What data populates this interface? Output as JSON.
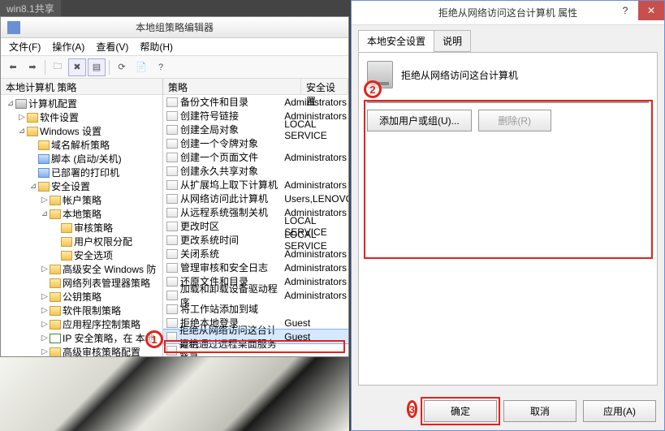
{
  "share_tab": "win8.1共享",
  "editor": {
    "title": "本地组策略编辑器",
    "menus": {
      "file": "文件(F)",
      "action": "操作(A)",
      "view": "查看(V)",
      "help": "帮助(H)"
    },
    "tree_header": "本地计算机 策略",
    "tree": [
      {
        "indent": 0,
        "tw": "⊿",
        "icon": "srv",
        "label": "计算机配置"
      },
      {
        "indent": 1,
        "tw": "▷",
        "icon": "f",
        "label": "软件设置"
      },
      {
        "indent": 1,
        "tw": "⊿",
        "icon": "f",
        "label": "Windows 设置"
      },
      {
        "indent": 2,
        "tw": "",
        "icon": "f",
        "label": "域名解析策略"
      },
      {
        "indent": 2,
        "tw": "",
        "icon": "blue",
        "label": "脚本 (启动/关机)"
      },
      {
        "indent": 2,
        "tw": "",
        "icon": "blue",
        "label": "已部署的打印机"
      },
      {
        "indent": 2,
        "tw": "⊿",
        "icon": "f",
        "label": "安全设置"
      },
      {
        "indent": 3,
        "tw": "▷",
        "icon": "f",
        "label": "帐户策略"
      },
      {
        "indent": 3,
        "tw": "⊿",
        "icon": "f",
        "label": "本地策略"
      },
      {
        "indent": 4,
        "tw": "",
        "icon": "f",
        "label": "审核策略"
      },
      {
        "indent": 4,
        "tw": "",
        "icon": "f",
        "label": "用户权限分配"
      },
      {
        "indent": 4,
        "tw": "",
        "icon": "f",
        "label": "安全选项"
      },
      {
        "indent": 3,
        "tw": "▷",
        "icon": "f",
        "label": "高级安全 Windows 防"
      },
      {
        "indent": 3,
        "tw": "",
        "icon": "f",
        "label": "网络列表管理器策略"
      },
      {
        "indent": 3,
        "tw": "▷",
        "icon": "f",
        "label": "公钥策略"
      },
      {
        "indent": 3,
        "tw": "▷",
        "icon": "f",
        "label": "软件限制策略"
      },
      {
        "indent": 3,
        "tw": "▷",
        "icon": "f",
        "label": "应用程序控制策略"
      },
      {
        "indent": 3,
        "tw": "▷",
        "icon": "ip",
        "label": "IP 安全策略，在 本地"
      },
      {
        "indent": 3,
        "tw": "▷",
        "icon": "f",
        "label": "高级审核策略配置"
      }
    ],
    "columns": {
      "policy": "策略",
      "setting": "安全设置"
    },
    "rows": [
      {
        "p": "备份文件和目录",
        "s": "Administrators"
      },
      {
        "p": "创建符号链接",
        "s": "Administrators"
      },
      {
        "p": "创建全局对象",
        "s": "LOCAL SERVICE"
      },
      {
        "p": "创建一个令牌对象",
        "s": ""
      },
      {
        "p": "创建一个页面文件",
        "s": "Administrators"
      },
      {
        "p": "创建永久共享对象",
        "s": ""
      },
      {
        "p": "从扩展坞上取下计算机",
        "s": "Administrators"
      },
      {
        "p": "从网络访问此计算机",
        "s": "Users,LENOVO"
      },
      {
        "p": "从远程系统强制关机",
        "s": "Administrators"
      },
      {
        "p": "更改时区",
        "s": "LOCAL SERVICE"
      },
      {
        "p": "更改系统时间",
        "s": "LOCAL SERVICE"
      },
      {
        "p": "关闭系统",
        "s": "Administrators"
      },
      {
        "p": "管理审核和安全日志",
        "s": "Administrators"
      },
      {
        "p": "还原文件和目录",
        "s": "Administrators"
      },
      {
        "p": "加载和卸载设备驱动程序",
        "s": "Administrators"
      },
      {
        "p": "将工作站添加到域",
        "s": ""
      },
      {
        "p": "拒绝本地登录",
        "s": "Guest"
      },
      {
        "p": "拒绝从网络访问这台计算机",
        "s": "Guest",
        "sel": true
      },
      {
        "p": "拒绝通过远程桌面服务登录",
        "s": ""
      }
    ]
  },
  "prop": {
    "title": "拒绝从网络访问这台计算机 属性",
    "tabs": {
      "security": "本地安全设置",
      "explain": "说明"
    },
    "heading": "拒绝从网络访问这台计算机",
    "add_btn": "添加用户或组(U)...",
    "remove_btn": "删除(R)",
    "ok": "确定",
    "cancel": "取消",
    "apply": "应用(A)",
    "help_icon": "?",
    "close_icon": "✕"
  },
  "annot": {
    "one": "1",
    "two": "2",
    "three": "3"
  }
}
